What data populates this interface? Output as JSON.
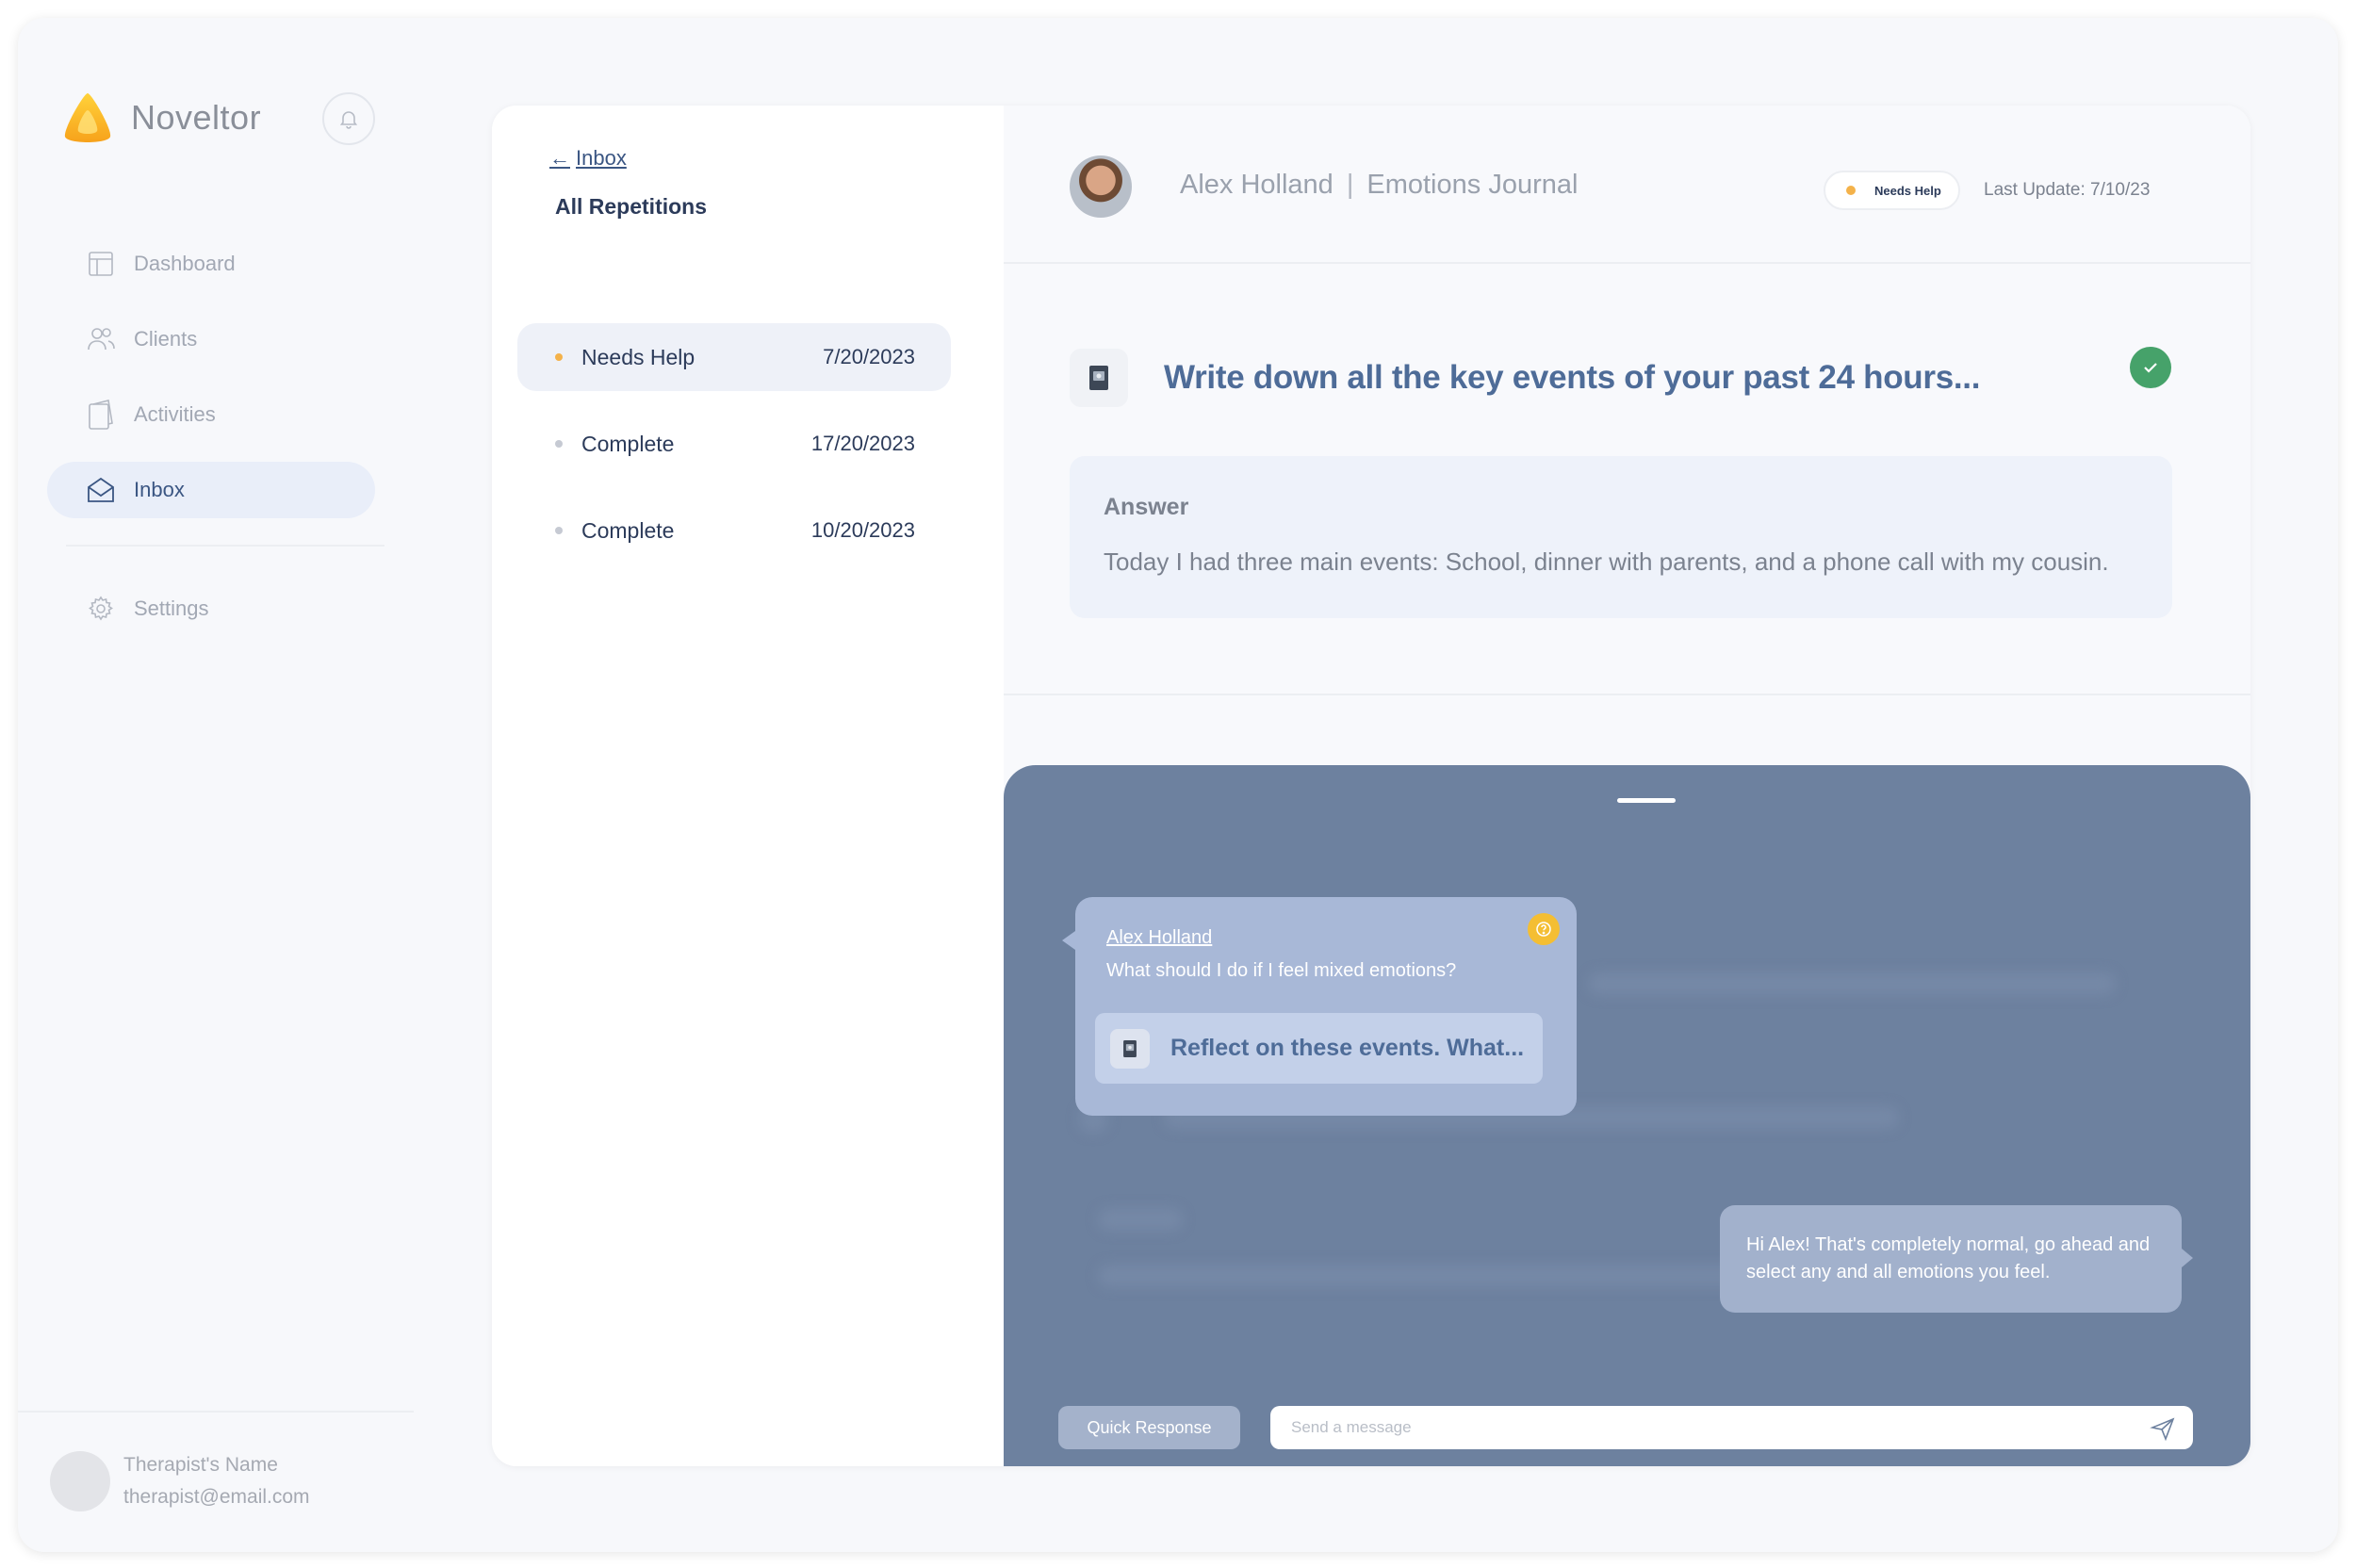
{
  "app": {
    "brand": "Noveltor"
  },
  "sidebar": {
    "items": [
      {
        "label": "Dashboard",
        "icon": "dashboard-icon"
      },
      {
        "label": "Clients",
        "icon": "users-icon"
      },
      {
        "label": "Activities",
        "icon": "activities-icon"
      },
      {
        "label": "Inbox",
        "icon": "inbox-icon",
        "active": true
      }
    ],
    "settings": {
      "label": "Settings",
      "icon": "gear-icon"
    },
    "profile": {
      "name": "Therapist's Name",
      "email": "therapist@email.com"
    }
  },
  "list": {
    "back_label": "Inbox",
    "title": "All Repetitions",
    "repetitions": [
      {
        "status": "Needs Help",
        "date": "7/20/2023",
        "active": true
      },
      {
        "status": "Complete",
        "date": "17/20/2023"
      },
      {
        "status": "Complete",
        "date": "10/20/2023"
      }
    ]
  },
  "detail": {
    "client_name": "Alex Holland",
    "separator": "|",
    "activity": "Emotions Journal",
    "badge": "Needs Help",
    "last_update": "Last Update: 7/10/23",
    "question": "Write down all the key events of your past 24 hours...",
    "answer_label": "Answer",
    "answer_text": "Today I had three main events: School, dinner with parents, and a phone call with my cousin."
  },
  "chat": {
    "incoming": {
      "sender": "Alex Holland",
      "message": "What should I do if I feel mixed emotions?",
      "reference": "Reflect on these events. What..."
    },
    "outgoing": {
      "message": "Hi Alex! That's completely normal, go ahead and select any and all emotions you feel."
    },
    "quick_response_label": "Quick Response",
    "input_placeholder": "Send a message"
  },
  "colors": {
    "accent": "#3b5683",
    "needs_help": "#f4b24a",
    "complete_check": "#46a26a",
    "chat_overlay": "#6d819f"
  }
}
